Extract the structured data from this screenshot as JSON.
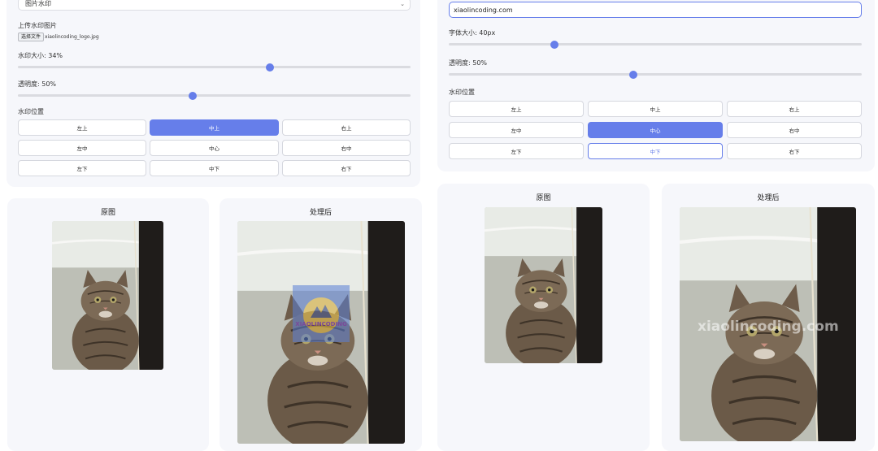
{
  "left": {
    "type_select": "图片水印",
    "upload_label": "上传水印图片",
    "file_button": "选择文件",
    "file_name": "xiaolincoding_logo.jpg",
    "size_label": "水印大小: 34%",
    "size_value": 0.34,
    "opacity_label": "透明度: 50%",
    "opacity_value": 0.5,
    "position_label": "水印位置",
    "positions": [
      "左上",
      "中上",
      "右上",
      "左中",
      "中心",
      "右中",
      "左下",
      "中下",
      "右下"
    ],
    "original_title": "原图",
    "processed_title": "处理后",
    "watermark_logo_text": "XIAOLINCODING"
  },
  "right": {
    "text_value": "xiaolincoding.com",
    "font_label": "字体大小: 40px",
    "font_value": 40,
    "opacity_label": "透明度: 50%",
    "opacity_value": 0.5,
    "position_label": "水印位置",
    "positions": [
      "左上",
      "中上",
      "右上",
      "左中",
      "中心",
      "右中",
      "左下",
      "中下",
      "右下"
    ],
    "original_title": "原图",
    "processed_title": "处理后",
    "watermark_text": "xiaolincoding.com"
  },
  "colors": {
    "accent": "#667eea",
    "panel": "#f6f7fb",
    "border": "#d6d8df"
  }
}
